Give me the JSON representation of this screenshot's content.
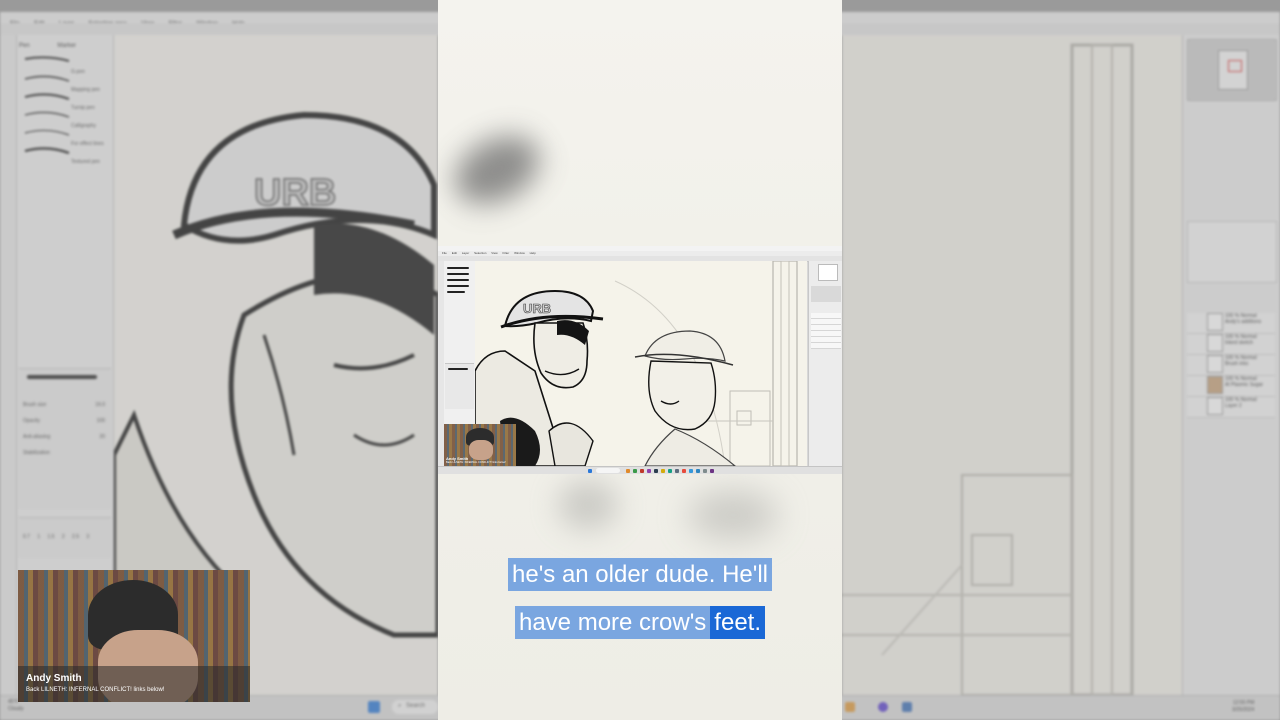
{
  "background_app": {
    "menu_items": [
      "File",
      "Edit",
      "Layer",
      "Selection area",
      "View",
      "Filter",
      "Window",
      "Help"
    ],
    "brush_panel_tabs": [
      "Pen",
      "Marker"
    ],
    "brush_list": [
      "G-pen",
      "Mapping pen",
      "Turnip pen",
      "Calligraphy",
      "For effect lines",
      "Textured pen"
    ],
    "tool_property": {
      "rows": [
        "Brush size",
        "Opacity",
        "Anti-aliasing",
        "Stabilization"
      ],
      "values": [
        "19.0",
        "100",
        "",
        "20"
      ]
    },
    "brush_size_presets": [
      "0.7",
      "1",
      "1.5",
      "2",
      "2.5",
      "3",
      "4",
      "5"
    ],
    "layers": [
      {
        "blend": "100 % Normal",
        "name": "Andy's additions"
      },
      {
        "blend": "100 % Normal",
        "name": "Inked sketch"
      },
      {
        "blend": "100 % Normal",
        "name": "Brush inks"
      },
      {
        "blend": "100 % Normal",
        "name": "Al Plasmic Sugar"
      },
      {
        "blend": "100 % Normal",
        "name": "Layer 2"
      }
    ],
    "taskbar": {
      "search_placeholder": "Search",
      "clock_time": "12:55 PM",
      "clock_date": "3/25/2024",
      "left_widget_temp": "45°F",
      "left_widget_label": "Cloudy"
    }
  },
  "webcam_overlay": {
    "name": "Andy Smith",
    "subtitle": "Back LILNETH: INFERNAL CONFLICT! links below!"
  },
  "inner_screenshot": {
    "cap_text": "URB",
    "menu_items": [
      "File",
      "Edit",
      "Layer",
      "Selection",
      "View",
      "Filter",
      "Window",
      "Help"
    ]
  },
  "captions": {
    "line1": "he's an older dude. He'll",
    "line2_plain": "have more crow's",
    "line2_highlight": "feet."
  }
}
